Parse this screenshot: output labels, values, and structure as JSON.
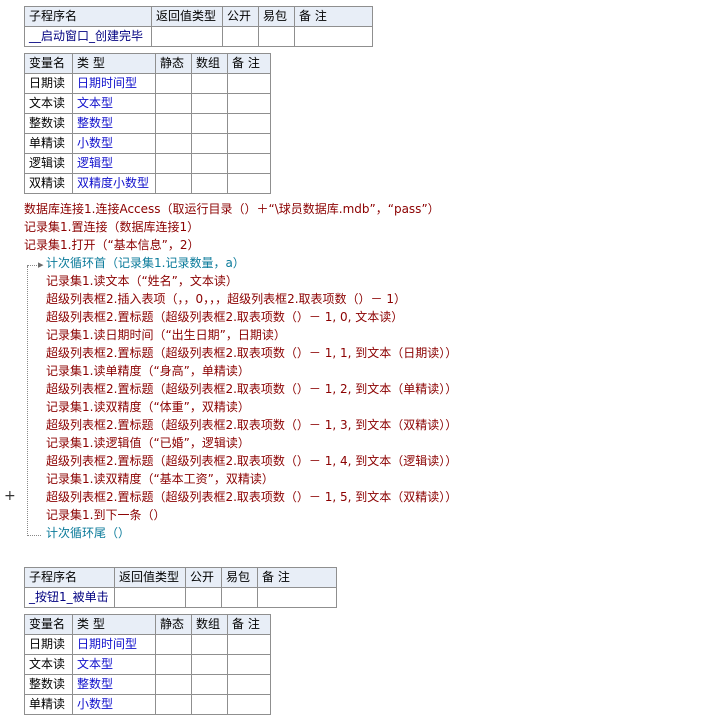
{
  "sub1": {
    "headers": [
      "子程序名",
      "返回值类型",
      "公开",
      "易包",
      "备 注"
    ],
    "name": "__启动窗口_创建完毕"
  },
  "vars1": {
    "headers": [
      "变量名",
      "类 型",
      "静态",
      "数组",
      "备 注"
    ],
    "rows": [
      {
        "name": "日期读",
        "type": "日期时间型"
      },
      {
        "name": "文本读",
        "type": "文本型"
      },
      {
        "name": "整数读",
        "type": "整数型"
      },
      {
        "name": "单精读",
        "type": "小数型"
      },
      {
        "name": "逻辑读",
        "type": "逻辑型"
      },
      {
        "name": "双精读",
        "type": "双精度小数型"
      }
    ]
  },
  "code": {
    "l1": "数据库连接1.连接Access（取运行目录（）＋“\\球员数据库.mdb”，“pass”）",
    "l2": "记录集1.置连接（数据库连接1）",
    "l3": "记录集1.打开（“基本信息”，2）",
    "l4": "计次循环首（记录集1.记录数量，a）",
    "l5": "记录集1.读文本（“姓名”，文本读）",
    "l6": "超级列表框2.插入表项（，，0，，，超级列表框2.取表项数（）－ 1）",
    "l7": "超级列表框2.置标题（超级列表框2.取表项数（）－ 1, 0, 文本读）",
    "l8": "记录集1.读日期时间（“出生日期”，日期读）",
    "l9": "超级列表框2.置标题（超级列表框2.取表项数（）－ 1, 1, 到文本（日期读））",
    "l10": "记录集1.读单精度（“身高”，单精读）",
    "l11": "超级列表框2.置标题（超级列表框2.取表项数（）－ 1, 2, 到文本（单精读））",
    "l12": "记录集1.读双精度（“体重”，双精读）",
    "l13": "超级列表框2.置标题（超级列表框2.取表项数（）－ 1, 3, 到文本（双精读））",
    "l14": "记录集1.读逻辑值（“已婚”，逻辑读）",
    "l15": "超级列表框2.置标题（超级列表框2.取表项数（）－ 1, 4, 到文本（逻辑读））",
    "l16": "记录集1.读双精度（“基本工资”，双精读）",
    "l17": "超级列表框2.置标题（超级列表框2.取表项数（）－ 1, 5, 到文本（双精读））",
    "l18": "记录集1.到下一条（）",
    "l19": "计次循环尾（）"
  },
  "plus_glyph": "+",
  "sub2": {
    "headers": [
      "子程序名",
      "返回值类型",
      "公开",
      "易包",
      "备 注"
    ],
    "name": "_按钮1_被单击"
  },
  "vars2": {
    "headers": [
      "变量名",
      "类 型",
      "静态",
      "数组",
      "备 注"
    ],
    "rows": [
      {
        "name": "日期读",
        "type": "日期时间型"
      },
      {
        "name": "文本读",
        "type": "文本型"
      },
      {
        "name": "整数读",
        "type": "整数型"
      },
      {
        "name": "单精读",
        "type": "小数型"
      }
    ]
  }
}
